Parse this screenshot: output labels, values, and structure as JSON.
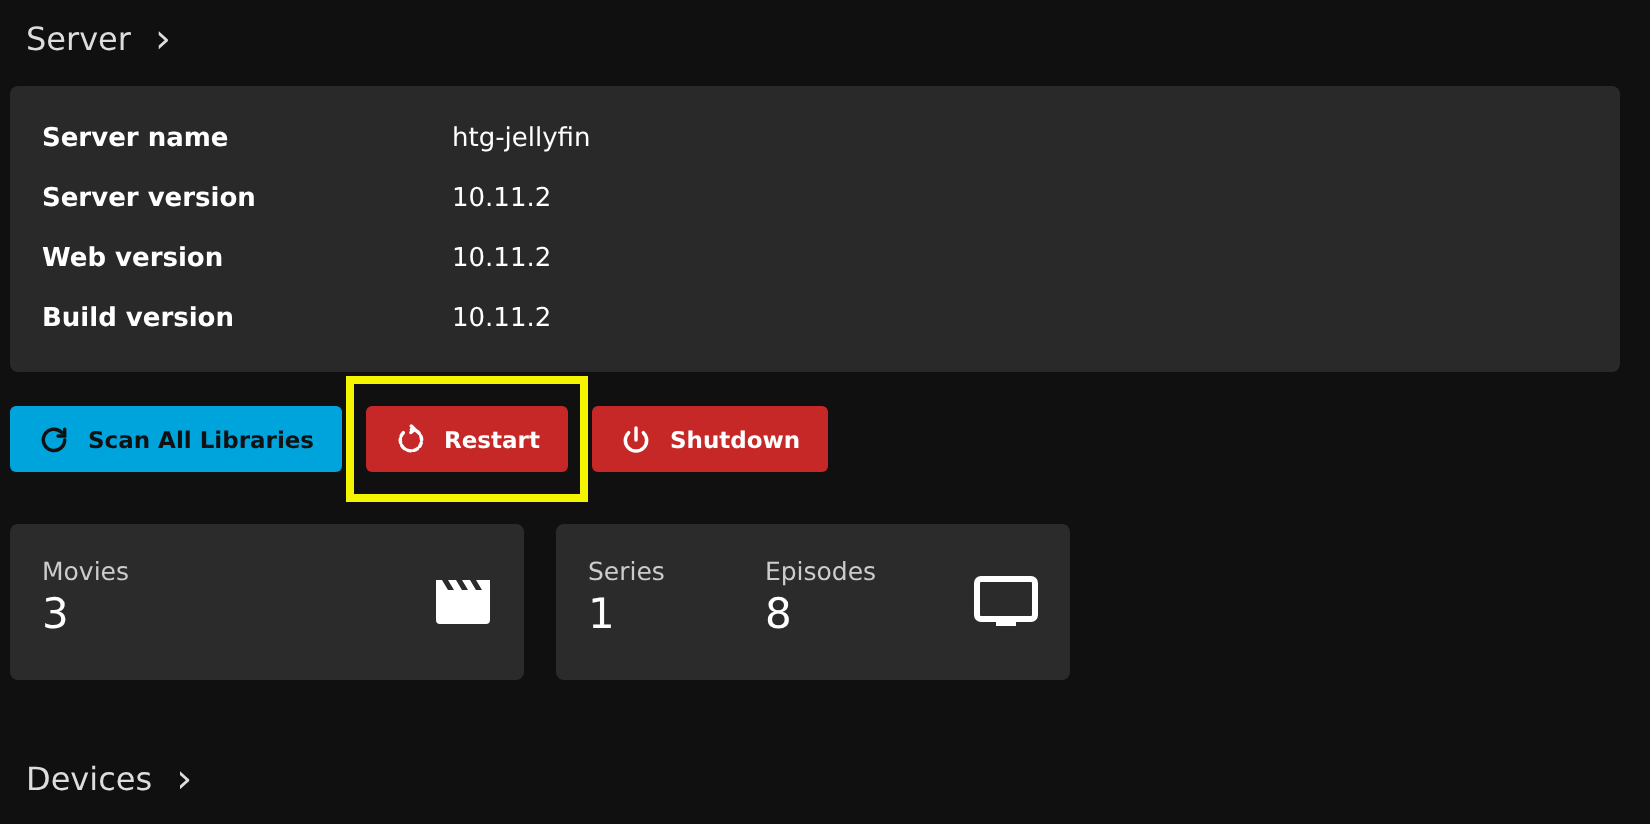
{
  "server_section": {
    "title": "Server",
    "chevron": "›"
  },
  "server_info": [
    {
      "label": "Server name",
      "value": "htg-jellyfin"
    },
    {
      "label": "Server version",
      "value": "10.11.2"
    },
    {
      "label": "Web version",
      "value": "10.11.2"
    },
    {
      "label": "Build version",
      "value": "10.11.2"
    }
  ],
  "actions": [
    {
      "kind": "refresh",
      "label": "Scan All Libraries",
      "color": "#00a4dc",
      "highlighted": false
    },
    {
      "kind": "restart",
      "label": "Restart",
      "color": "#c62828",
      "highlighted": true
    },
    {
      "kind": "power",
      "label": "Shutdown",
      "color": "#c62828",
      "highlighted": false
    }
  ],
  "stat_cards": [
    {
      "kind": "movies",
      "items": [
        {
          "label": "Movies",
          "value": "3"
        }
      ]
    },
    {
      "kind": "tv",
      "items": [
        {
          "label": "Series",
          "value": "1"
        },
        {
          "label": "Episodes",
          "value": "8"
        }
      ]
    }
  ],
  "devices_section": {
    "title": "Devices",
    "chevron": "›"
  }
}
